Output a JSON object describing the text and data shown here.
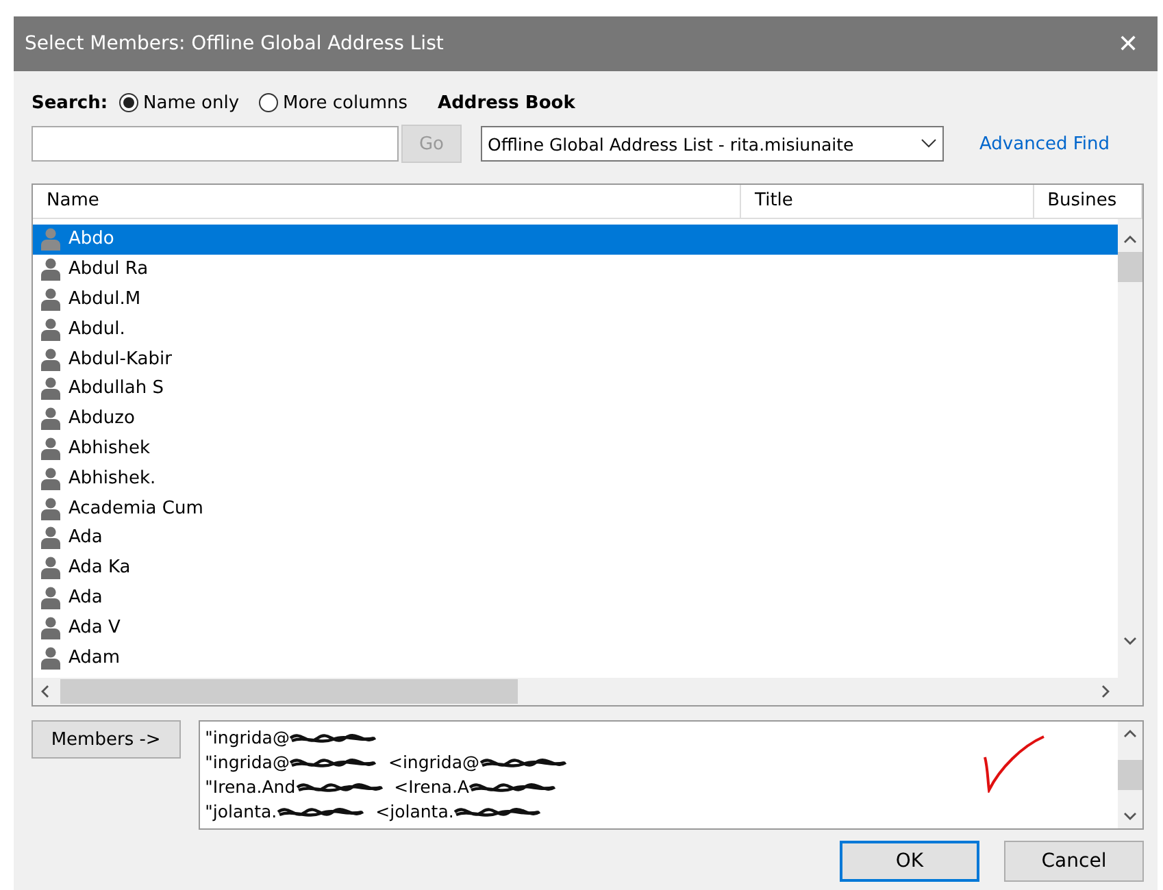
{
  "window": {
    "title": "Select Members: Offline Global Address List",
    "close": "✕"
  },
  "search": {
    "label": "Search:",
    "options": [
      {
        "label": "Name only",
        "selected": true
      },
      {
        "label": "More columns",
        "selected": false
      }
    ],
    "go": "Go",
    "go_disabled": true
  },
  "address_book": {
    "label": "Address Book",
    "value": "Offline Global Address List - rita.misiunaite",
    "advanced_find": "Advanced Find"
  },
  "table": {
    "columns": [
      "Name",
      "Title",
      "Busines"
    ],
    "rows": [
      {
        "name": "Abdo",
        "selected": true
      },
      {
        "name": "Abdul Ra",
        "selected": false
      },
      {
        "name": "Abdul.M",
        "selected": false
      },
      {
        "name": "Abdul.",
        "selected": false
      },
      {
        "name": "Abdul-Kabir",
        "selected": false
      },
      {
        "name": "Abdullah S",
        "selected": false
      },
      {
        "name": "Abduzo",
        "selected": false
      },
      {
        "name": "Abhishek",
        "selected": false
      },
      {
        "name": "Abhishek.",
        "selected": false
      },
      {
        "name": "Academia Cum",
        "selected": false
      },
      {
        "name": "Ada",
        "selected": false
      },
      {
        "name": "Ada Ka",
        "selected": false
      },
      {
        "name": "Ada",
        "selected": false
      },
      {
        "name": "Ada V",
        "selected": false
      },
      {
        "name": "Adam",
        "selected": false
      }
    ]
  },
  "members": {
    "button": "Members ->",
    "lines": [
      [
        {
          "text": "\"ingrida@",
          "redacted": true
        }
      ],
      [
        {
          "text": "\"ingrida@",
          "redacted": true
        },
        {
          "text": "<ingrida@",
          "redacted": true
        }
      ],
      [
        {
          "text": "\"Irena.And",
          "redacted": true
        },
        {
          "text": "<Irena.A",
          "redacted": true
        }
      ],
      [
        {
          "text": "\"jolanta.",
          "redacted": true
        },
        {
          "text": "<jolanta.",
          "redacted": true
        }
      ]
    ]
  },
  "buttons": [
    {
      "label": "OK",
      "default": true
    },
    {
      "label": "Cancel",
      "default": false
    }
  ]
}
